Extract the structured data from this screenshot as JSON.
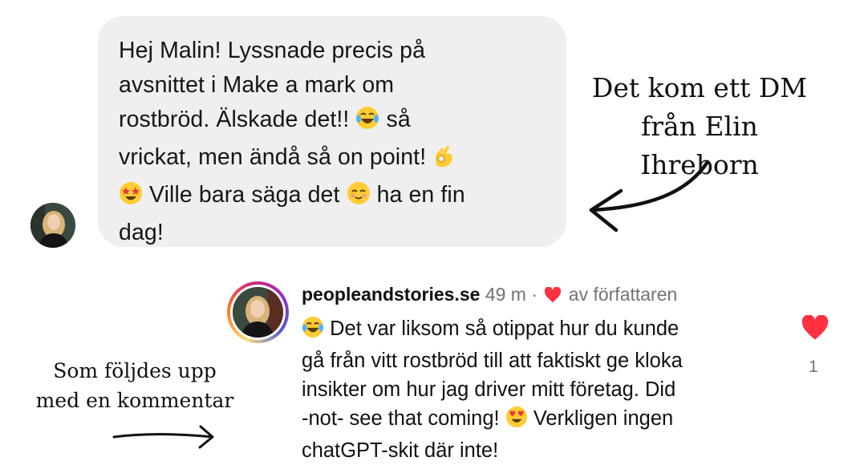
{
  "dm": {
    "line1": "Hej Malin! Lyssnade precis på",
    "line2": "avsnittet i Make a mark om",
    "line3_a": "rostbröd. Älskade det!!",
    "line3_b": "så",
    "line4_a": "vrickat, men ändå så on point!",
    "line5_a": "Ville bara säga det",
    "line5_b": "ha en fin",
    "line6": "dag!"
  },
  "annotations": {
    "top_line1": "Det kom ett DM",
    "top_line2": "från Elin Ihreborn",
    "bottom_line1": "Som följdes upp",
    "bottom_line2": "med en kommentar"
  },
  "comment": {
    "username": "peopleandstories.se",
    "time": "49 m ·",
    "liked_by": "av författaren",
    "line1": "Det var liksom så otippat hur du kunde",
    "line2": "gå från vitt rostbröd till att faktiskt ge kloka",
    "line3": "insikter om hur jag driver mitt företag. Did",
    "line4_a": "-not- see that coming!",
    "line4_b": "Verkligen ingen",
    "line5": "chatGPT-skit där inte!",
    "like_count": "1"
  },
  "icons": {
    "dm_emoji_1": "tears-of-joy-emoji",
    "dm_emoji_2": "ok-hand-emoji",
    "dm_emoji_3": "star-struck-emoji",
    "dm_emoji_4": "smiling-blush-emoji",
    "comment_emoji_1": "tears-of-joy-emoji",
    "comment_emoji_2": "heart-eyes-emoji",
    "heart": "heart-icon"
  },
  "colors": {
    "bubble": "#efefef",
    "heart": "#ff3040",
    "meta": "#737373",
    "emoji_yellow": "#ffcc33"
  }
}
